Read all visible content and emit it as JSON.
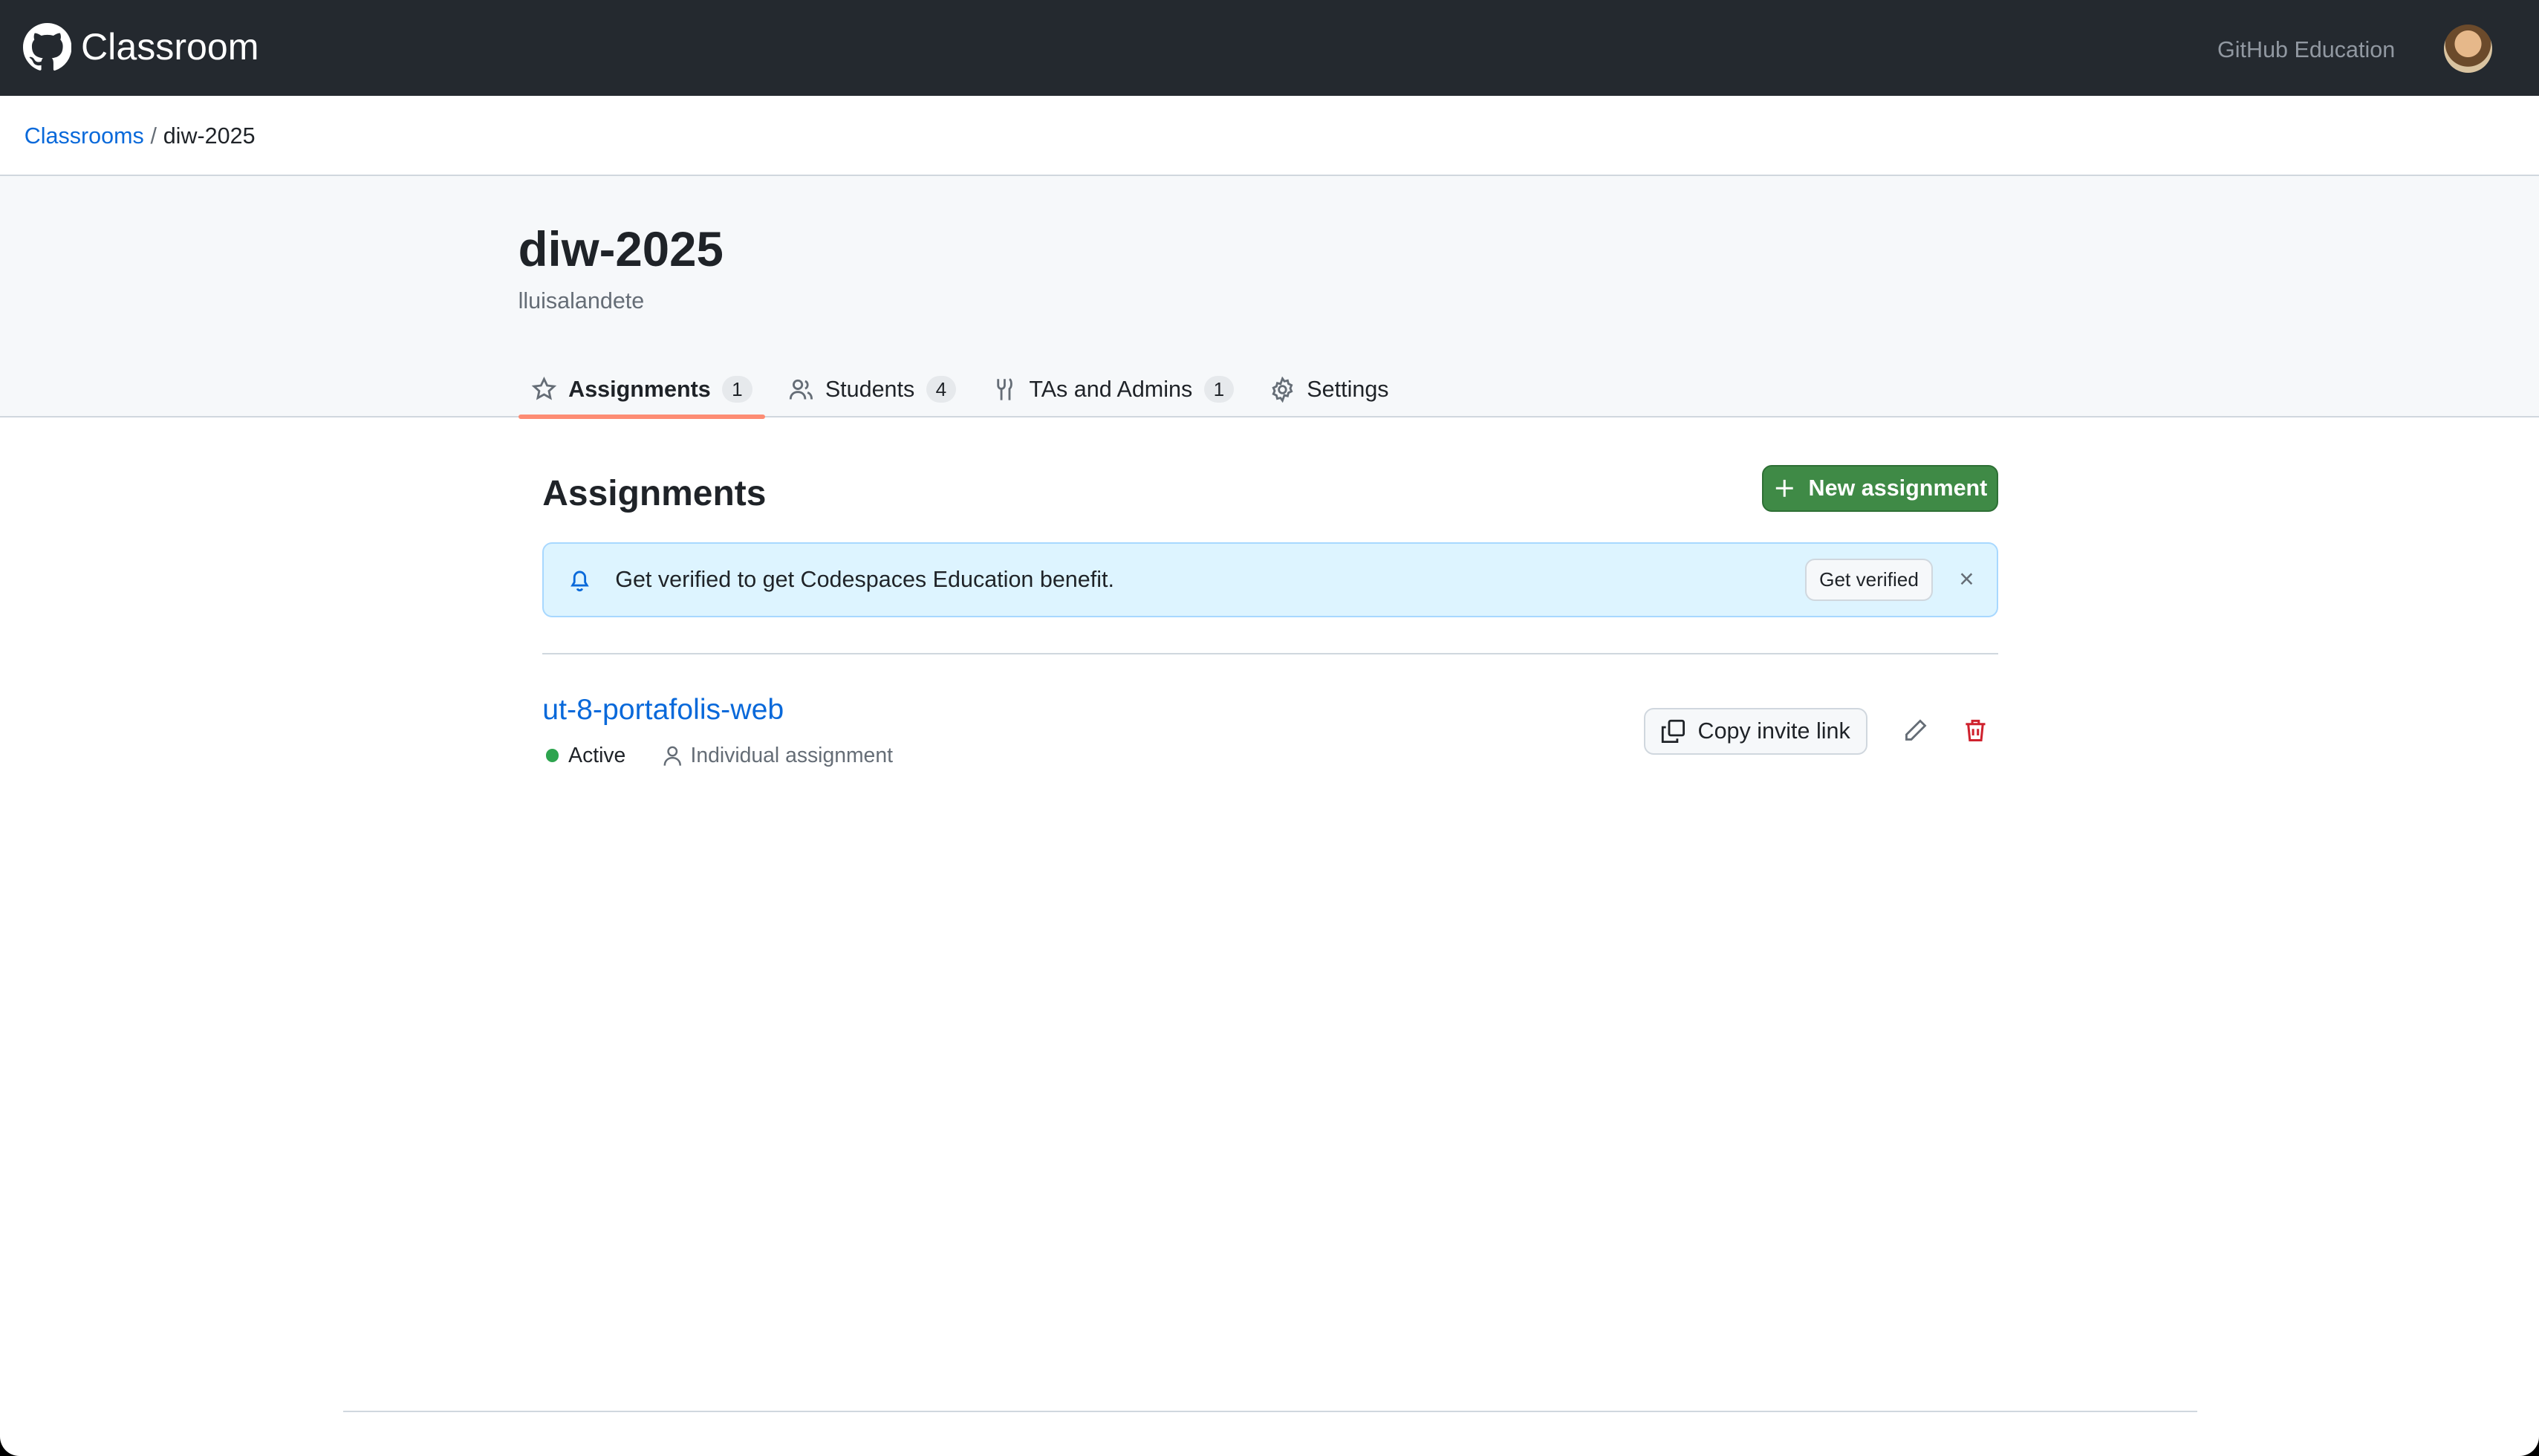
{
  "nav": {
    "brand": "Classroom",
    "link": "GitHub Education"
  },
  "breadcrumb": {
    "root": "Classrooms",
    "sep": "/",
    "current": "diw-2025"
  },
  "classroom": {
    "title": "diw-2025",
    "owner": "lluisalandete"
  },
  "tabs": [
    {
      "label": "Assignments",
      "count": "1"
    },
    {
      "label": "Students",
      "count": "4"
    },
    {
      "label": "TAs and Admins",
      "count": "1"
    },
    {
      "label": "Settings"
    }
  ],
  "assignments": {
    "heading": "Assignments",
    "new_button": "New assignment",
    "banner": {
      "text": "Get verified to get Codespaces Education benefit.",
      "button": "Get verified",
      "close": "×"
    },
    "items": [
      {
        "name": "ut-8-portafolis-web",
        "status": "Active",
        "type": "Individual assignment",
        "copy_label": "Copy invite link"
      }
    ]
  },
  "colors": {
    "accent": "#0969da",
    "primary": "#3f8a46",
    "danger": "#cf222e",
    "tab_underline": "#fd8c73"
  }
}
